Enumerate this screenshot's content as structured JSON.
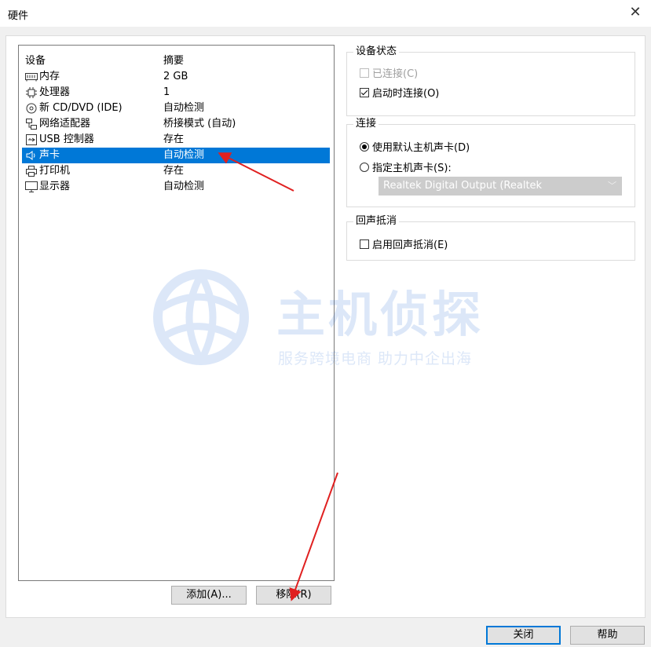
{
  "window": {
    "title": "硬件",
    "close_glyph": "✕"
  },
  "device_list": {
    "header_device": "设备",
    "header_summary": "摘要",
    "rows": [
      {
        "icon": "memory-icon",
        "device": "内存",
        "summary": "2 GB",
        "selected": false
      },
      {
        "icon": "processor-icon",
        "device": "处理器",
        "summary": "1",
        "selected": false
      },
      {
        "icon": "cd-dvd-icon",
        "device": "新 CD/DVD (IDE)",
        "summary": "自动检测",
        "selected": false
      },
      {
        "icon": "network-adapter-icon",
        "device": "网络适配器",
        "summary": "桥接模式 (自动)",
        "selected": false
      },
      {
        "icon": "usb-icon",
        "device": "USB 控制器",
        "summary": "存在",
        "selected": false
      },
      {
        "icon": "sound-card-icon",
        "device": "声卡",
        "summary": "自动检测",
        "selected": true
      },
      {
        "icon": "printer-icon",
        "device": "打印机",
        "summary": "存在",
        "selected": false
      },
      {
        "icon": "display-icon",
        "device": "显示器",
        "summary": "自动检测",
        "selected": false
      }
    ]
  },
  "buttons": {
    "add": "添加(A)...",
    "remove": "移除(R)",
    "close": "关闭",
    "help": "帮助"
  },
  "device_status": {
    "label": "设备状态",
    "connected": {
      "label": "已连接(C)",
      "checked": false,
      "disabled": true
    },
    "connect_at_power_on": {
      "label": "启动时连接(O)",
      "checked": true,
      "disabled": false
    }
  },
  "connection": {
    "label": "连接",
    "use_default": {
      "label": "使用默认主机声卡(D)",
      "selected": true
    },
    "specify": {
      "label": "指定主机声卡(S):",
      "selected": false
    },
    "host_card_select": {
      "value": "Realtek Digital Output (Realtek",
      "disabled": true
    }
  },
  "echo_cancel": {
    "label": "回声抵消",
    "enable": {
      "label": "启用回声抵消(E)",
      "checked": false
    }
  },
  "watermark": {
    "title": "主机侦探",
    "subtitle": "服务跨境电商 助力中企出海"
  },
  "colors": {
    "selection": "#0078d7",
    "annotation_arrow": "#e02020",
    "watermark": "#2b6fd6"
  }
}
